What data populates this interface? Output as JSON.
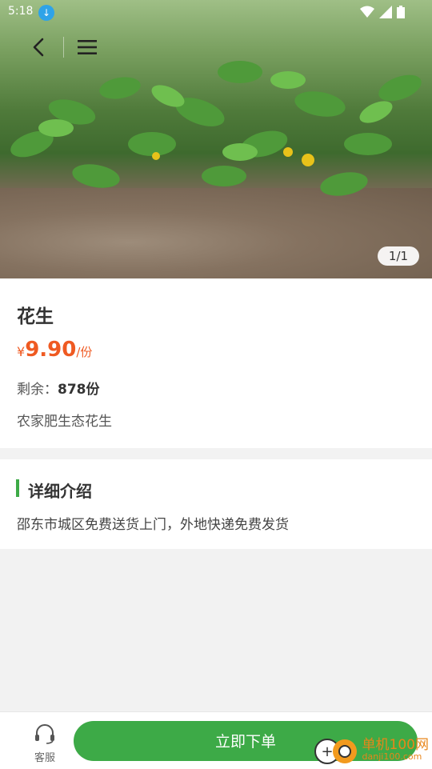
{
  "status_bar": {
    "time": "5:18"
  },
  "hero": {
    "image_counter": "1/1"
  },
  "product": {
    "title": "花生",
    "price_currency": "¥",
    "price_value": "9.90",
    "price_unit": "/份",
    "stock_label": "剩余：",
    "stock_value": "878份",
    "description": "农家肥生态花生"
  },
  "detail": {
    "heading": "详细介绍",
    "text": "邵东市城区免费送货上门，外地快递免费发货"
  },
  "bottom_bar": {
    "service_label": "客服",
    "buy_label": "立即下单"
  },
  "watermark": {
    "line1": "单机100网",
    "line2": "danji100.com"
  },
  "colors": {
    "accent": "#3daa47",
    "price": "#ef5a22"
  }
}
